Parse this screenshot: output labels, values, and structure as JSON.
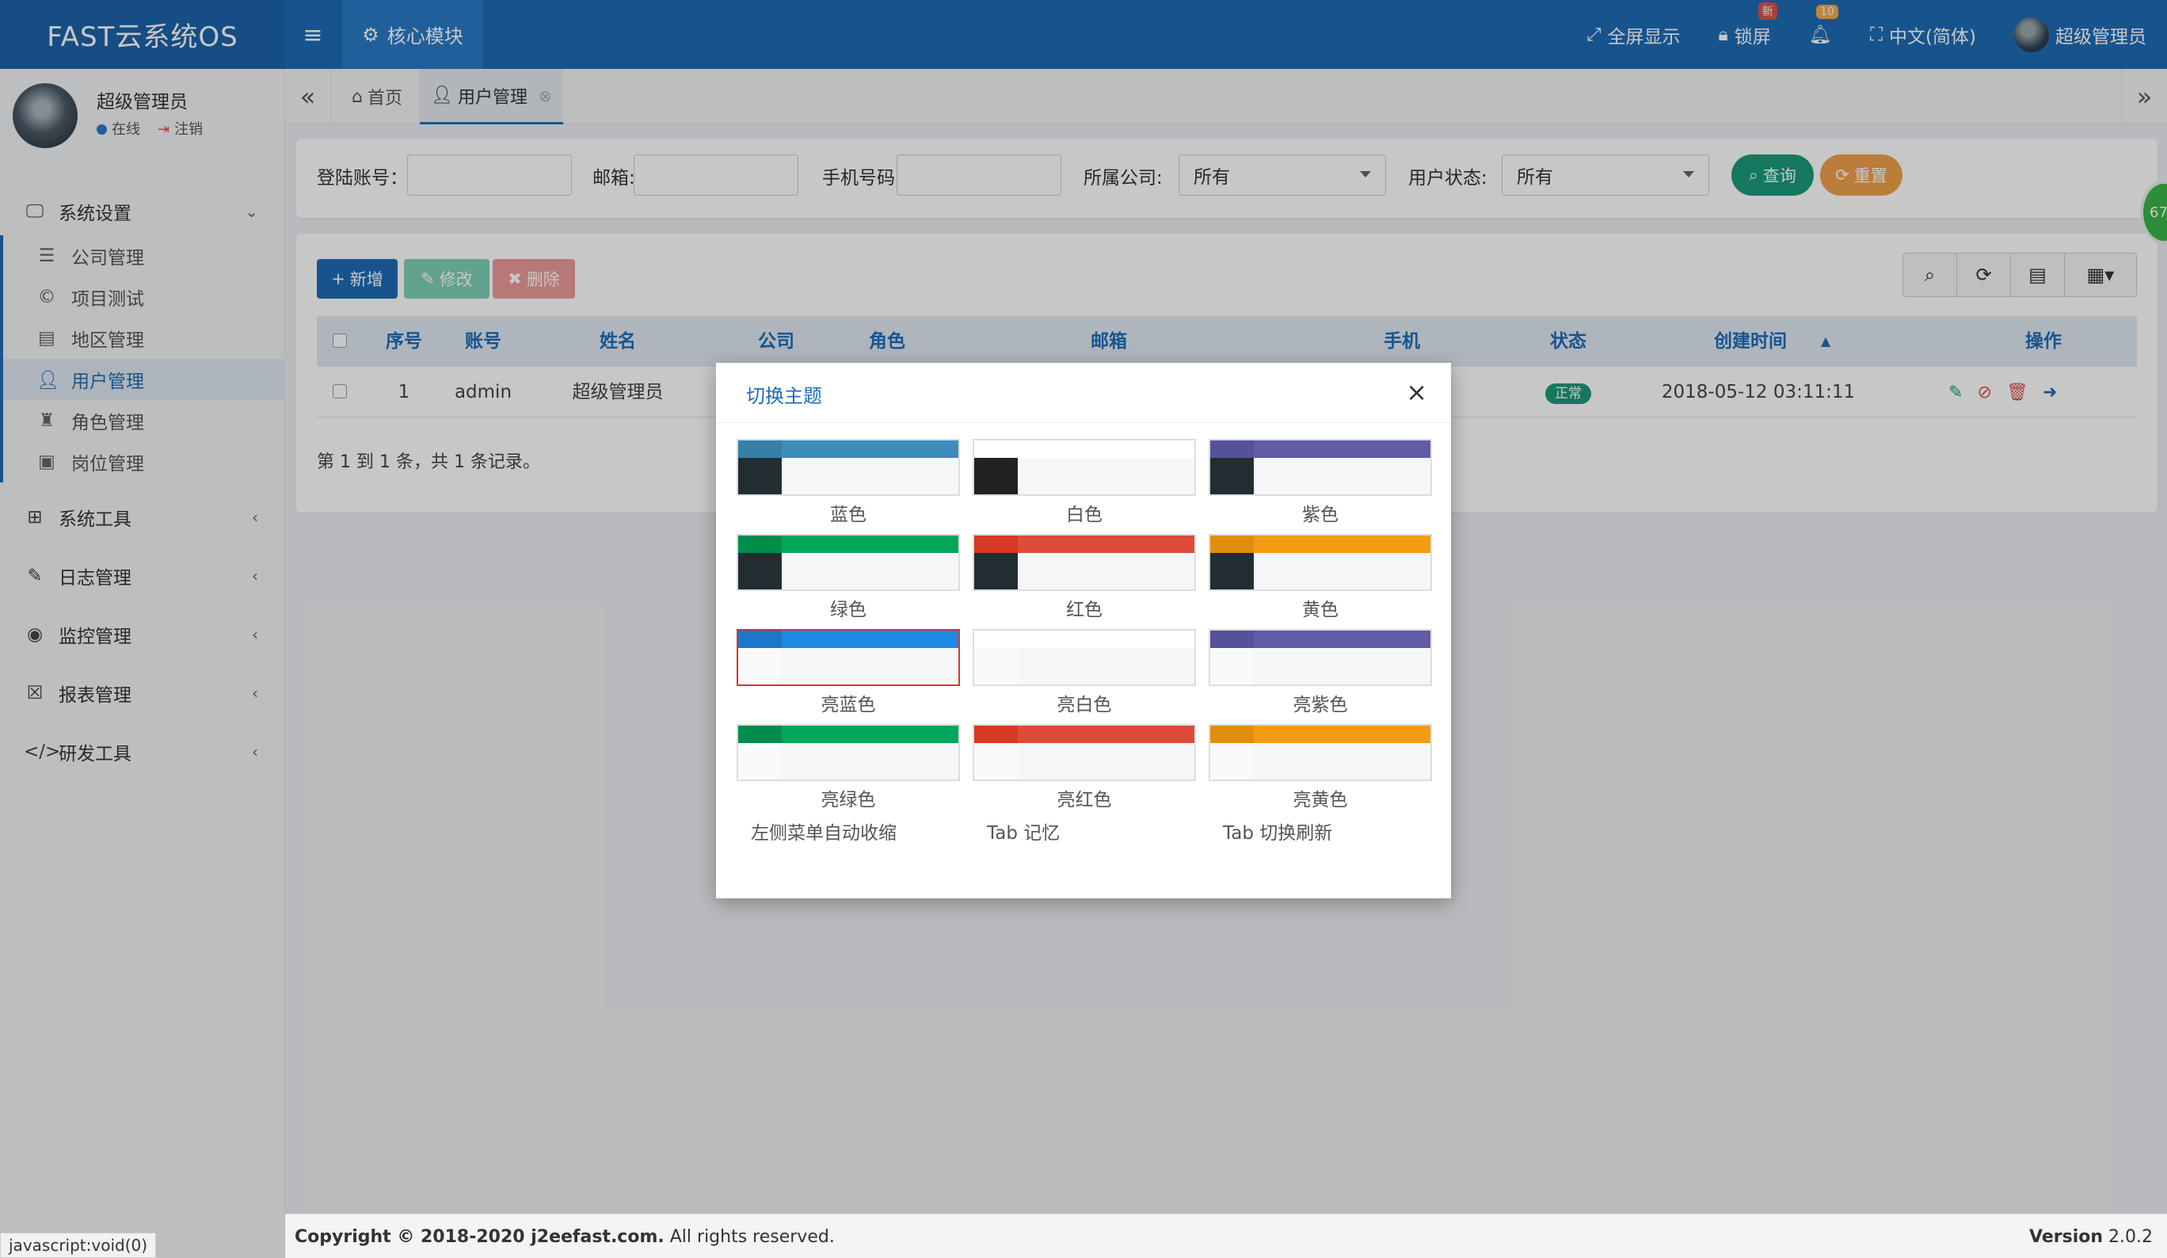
{
  "topbar": {
    "logo": "FAST云系统OS",
    "core_tab": "核心模块",
    "fullscreen": "全屏显示",
    "lock": "锁屏",
    "lock_badge": "新",
    "bell_badge": "10",
    "language": "中文(简体)",
    "user": "超级管理员"
  },
  "sidebar": {
    "user_name": "超级管理员",
    "online": "在线",
    "logout": "注销",
    "groups": [
      {
        "label": "系统设置",
        "icon": "monitor-icon",
        "expanded": true,
        "items": [
          {
            "label": "公司管理",
            "icon": "list-icon"
          },
          {
            "label": "项目测试",
            "icon": "copyright-icon"
          },
          {
            "label": "地区管理",
            "icon": "table-list-icon"
          },
          {
            "label": "用户管理",
            "icon": "user-icon",
            "active": true
          },
          {
            "label": "角色管理",
            "icon": "role-icon"
          },
          {
            "label": "岗位管理",
            "icon": "id-card-icon"
          }
        ]
      },
      {
        "label": "系统工具",
        "icon": "windows-icon"
      },
      {
        "label": "日志管理",
        "icon": "edit-icon"
      },
      {
        "label": "监控管理",
        "icon": "eye-icon"
      },
      {
        "label": "报表管理",
        "icon": "excel-icon"
      },
      {
        "label": "研发工具",
        "icon": "code-icon"
      }
    ]
  },
  "tabs": {
    "home": "首页",
    "user": "用户管理"
  },
  "search": {
    "login_label": "登陆账号：",
    "email_label": "邮箱:",
    "phone_label": "手机号码:",
    "company_label": "所属公司:",
    "company_value": "所有",
    "status_label": "用户状态:",
    "status_value": "所有",
    "query": "查询",
    "reset": "重置"
  },
  "table": {
    "add": "新增",
    "edit": "修改",
    "delete": "删除",
    "headers": [
      "序号",
      "账号",
      "姓名",
      "公司",
      "角色",
      "邮箱",
      "手机",
      "状态",
      "创建时间",
      "操作"
    ],
    "rows": [
      {
        "no": "1",
        "account": "admin",
        "name": "超级管理员",
        "status": "正常",
        "created": "2018-05-12 03:11:11"
      }
    ],
    "count": "第 1 到 1 条，共 1 条记录。"
  },
  "float_badge": "67",
  "modal": {
    "title": "切换主题",
    "themes": [
      {
        "label": "蓝色",
        "bar": "#3c8dbc",
        "logo": "#367fa9",
        "side": "#222d32"
      },
      {
        "label": "白色",
        "bar": "#ffffff",
        "logo": "#ffffff",
        "side": "#222222"
      },
      {
        "label": "紫色",
        "bar": "#605ca8",
        "logo": "#555299",
        "side": "#222d32"
      },
      {
        "label": "绿色",
        "bar": "#00a65a",
        "logo": "#008d4c",
        "side": "#222d32"
      },
      {
        "label": "红色",
        "bar": "#dd4b39",
        "logo": "#d73925",
        "side": "#222d32"
      },
      {
        "label": "黄色",
        "bar": "#f39c12",
        "logo": "#e08e0b",
        "side": "#222d32"
      },
      {
        "label": "亮蓝色",
        "bar": "#1e88e5",
        "logo": "#1a77cc",
        "side": "#f9fafc",
        "selected": true
      },
      {
        "label": "亮白色",
        "bar": "#ffffff",
        "logo": "#ffffff",
        "side": "#f9fafc"
      },
      {
        "label": "亮紫色",
        "bar": "#605ca8",
        "logo": "#555299",
        "side": "#f9fafc"
      },
      {
        "label": "亮绿色",
        "bar": "#00a65a",
        "logo": "#008d4c",
        "side": "#f9fafc"
      },
      {
        "label": "亮红色",
        "bar": "#dd4b39",
        "logo": "#d73925",
        "side": "#f9fafc"
      },
      {
        "label": "亮黄色",
        "bar": "#f39c12",
        "logo": "#e08e0b",
        "side": "#f9fafc"
      }
    ],
    "toggles": [
      "左侧菜单自动收缩",
      "Tab 记忆",
      "Tab 切换刷新"
    ]
  },
  "footer": {
    "copyright": "Copyright © 2018-2020 j2eefast.com.",
    "rights": "All rights reserved.",
    "version_label": "Version",
    "version": "2.0.2"
  },
  "status_url": "javascript:void(0)"
}
